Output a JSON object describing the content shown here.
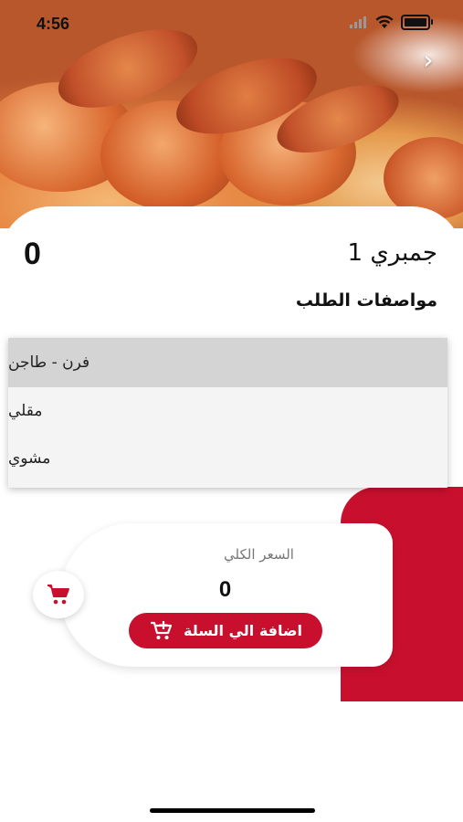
{
  "status_bar": {
    "time": "4:56"
  },
  "product": {
    "name": "جمبري 1",
    "price": "0"
  },
  "order_specs": {
    "title": "مواصفات الطلب",
    "options": [
      "فرن - طاجن",
      "مقلي",
      "مشوي"
    ],
    "selected_index": 0
  },
  "summary": {
    "total_label": "السعر الكلي",
    "total_value": "0",
    "add_to_cart_label": "اضافة الي السلة"
  },
  "colors": {
    "accent": "#c8102e",
    "dropdown_selected": "#d4d4d4"
  },
  "icons": [
    "back-chevron-icon",
    "wifi-icon",
    "signal-icon",
    "battery-icon",
    "cart-add-icon",
    "cart-icon"
  ]
}
